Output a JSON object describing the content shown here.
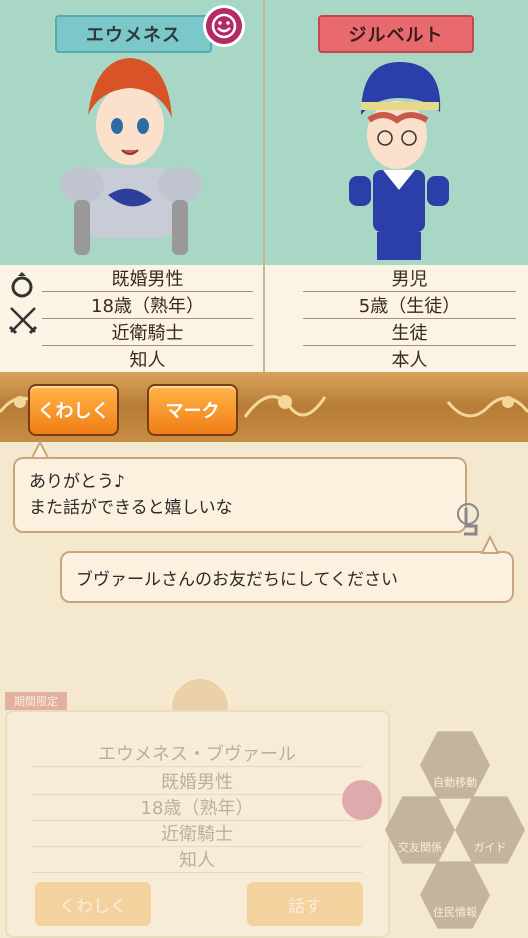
{
  "left": {
    "name": "エウメネス",
    "info": [
      "既婚男性",
      "18歳（熟年）",
      "近衛騎士",
      "知人"
    ]
  },
  "right": {
    "name": "ジルベルト",
    "info": [
      "男児",
      "5歳（生徒）",
      "生徒",
      "本人"
    ]
  },
  "buttons": {
    "details": "くわしく",
    "mark": "マーク"
  },
  "dialog": {
    "line1": "ありがとう♪",
    "line2": "また話ができると嬉しいな",
    "choice": "ブヴァールさんのお友だちにしてください"
  },
  "background_card": {
    "badge": "期間限定",
    "full_name": "エウメネス・ブヴァール",
    "info": [
      "既婚男性",
      "18歳（熟年）",
      "近衛騎士",
      "知人"
    ],
    "details_label": "くわしく",
    "talk_label": "話す"
  },
  "side_menu": {
    "auto": "自動移動",
    "friends": "交友関係",
    "guide": "ガイド",
    "info": "住民情報"
  },
  "colors": {
    "left_tag": "#7cc7c9",
    "right_tag": "#e86a6f",
    "button": "#f07e15",
    "panel": "#a9d7c5"
  }
}
